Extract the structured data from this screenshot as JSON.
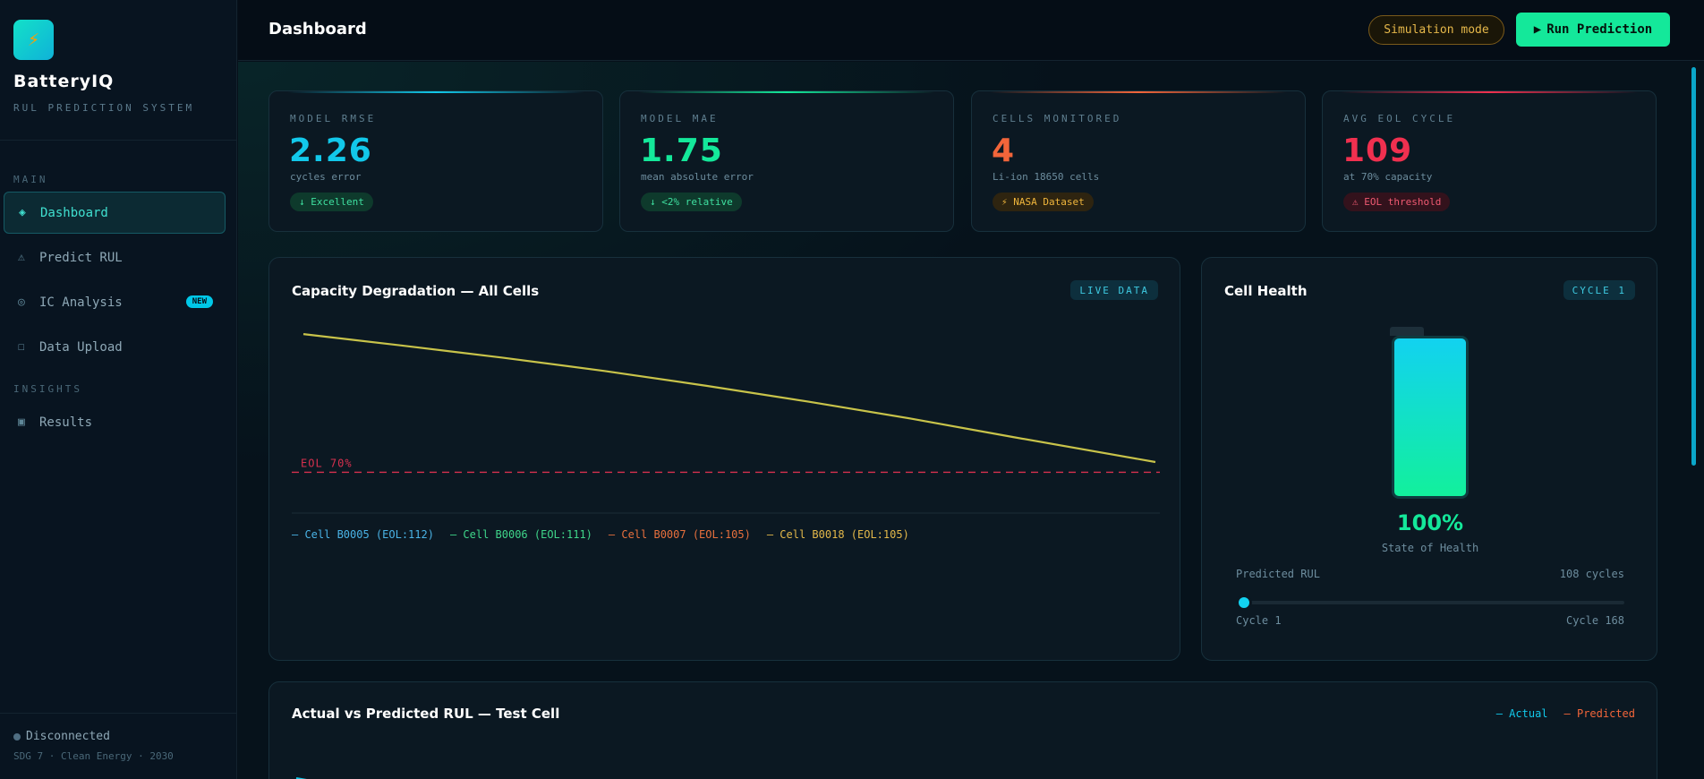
{
  "brand": {
    "icon": "lightning-icon",
    "name": "BatteryIQ",
    "subtitle": "RUL PREDICTION SYSTEM"
  },
  "sidebar": {
    "sections": [
      {
        "label": "MAIN"
      },
      {
        "label": "INSIGHTS"
      }
    ],
    "items": [
      {
        "label": "Dashboard",
        "icon": "◈",
        "active": true
      },
      {
        "label": "Predict RUL",
        "icon": "⚠"
      },
      {
        "label": "IC Analysis",
        "icon": "◎",
        "badge": "NEW"
      },
      {
        "label": "Data Upload",
        "icon": "☐"
      },
      {
        "label": "Results",
        "icon": "▣"
      }
    ],
    "status": "Disconnected",
    "footer": "SDG 7 · Clean Energy · 2030"
  },
  "topbar": {
    "title": "Dashboard",
    "sim_label": "Simulation mode",
    "run_label": "Run Prediction",
    "run_icon": "▶"
  },
  "stats": [
    {
      "label": "MODEL RMSE",
      "value": "2.26",
      "sub": "cycles error",
      "pill": "↓ Excellent",
      "color": "#12c8ea"
    },
    {
      "label": "MODEL MAE",
      "value": "1.75",
      "sub": "mean absolute error",
      "pill": "↓ <2% relative",
      "color": "#14e89a"
    },
    {
      "label": "CELLS MONITORED",
      "value": "4",
      "sub": "Li-ion 18650 cells",
      "pill": "⚡ NASA Dataset",
      "color": "#f2653a"
    },
    {
      "label": "AVG EOL CYCLE",
      "value": "109",
      "sub": "at 70% capacity",
      "pill": "⚠ EOL threshold",
      "color": "#f0304f"
    }
  ],
  "capacity_panel": {
    "title": "Capacity Degradation — All Cells",
    "tag": "LIVE DATA",
    "eol_label": "EOL 70%",
    "legend": [
      {
        "text": "— Cell B0005 (EOL:112)",
        "color": "#4ab3e6"
      },
      {
        "text": "— Cell B0006 (EOL:111)",
        "color": "#3fd68a"
      },
      {
        "text": "— Cell B0007 (EOL:105)",
        "color": "#e8703d"
      },
      {
        "text": "— Cell B0018 (EOL:105)",
        "color": "#e3b84a"
      }
    ]
  },
  "chart_data": {
    "type": "line",
    "series": [
      {
        "name": "Cell B0018 (EOL:105)",
        "x": [
          1,
          20,
          40,
          60,
          80,
          100,
          120,
          140,
          168
        ],
        "y": [
          0.97,
          0.948,
          0.924,
          0.898,
          0.869,
          0.838,
          0.805,
          0.769,
          0.72
        ]
      }
    ],
    "eol_threshold": 0.7,
    "xlim": [
      1,
      168
    ],
    "ylim": [
      0.65,
      1.0
    ],
    "line_color": "#c8c34a",
    "eol_color": "#d6304e"
  },
  "health_panel": {
    "title": "Cell Health",
    "tag": "CYCLE 1",
    "soh": "100%",
    "soh_label": "State of Health",
    "soh_fraction": 1.0,
    "rul_label": "Predicted RUL",
    "rul_value": "108 cycles",
    "cycle_min": "Cycle 1",
    "cycle_max": "Cycle 168",
    "slider_fraction": 0.0
  },
  "rul_panel": {
    "title": "Actual vs Predicted RUL — Test Cell",
    "legend_actual": "— Actual",
    "legend_predicted": "— Predicted"
  }
}
